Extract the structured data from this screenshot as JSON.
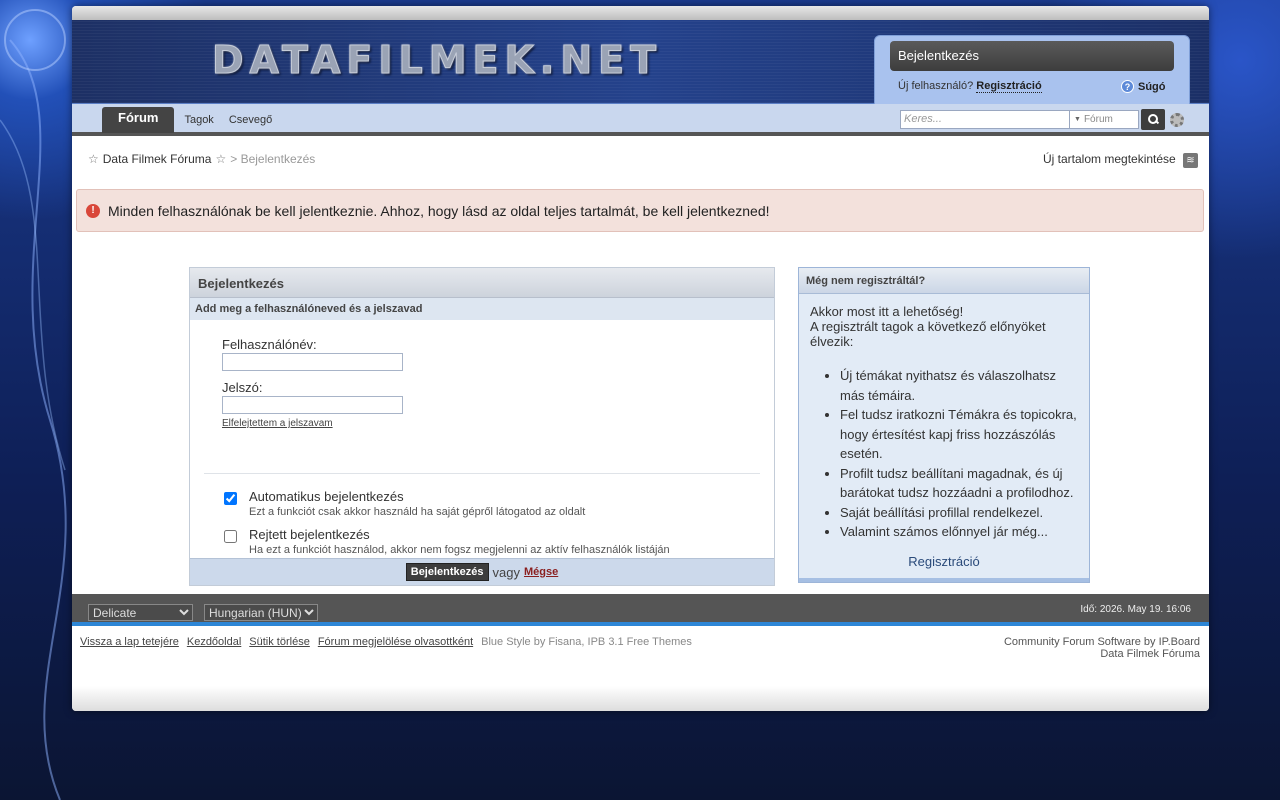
{
  "header": {
    "logo_text": "DATAFILMEK.NET",
    "login_button": "Bejelentkezés",
    "new_user_label": "Új felhasználó?",
    "register_link": "Regisztráció",
    "help_label": "Súgó"
  },
  "nav": {
    "tabs": [
      {
        "label": "Fórum",
        "active": true
      },
      {
        "label": "Tagok",
        "active": false
      },
      {
        "label": "Csevegő",
        "active": false
      }
    ],
    "search_placeholder": "Keres...",
    "search_scope": "Fórum"
  },
  "breadcrumb": {
    "home": "Data Filmek Fóruma",
    "current": "> Bejelentkezés"
  },
  "new_content": "Új tartalom megtekintése",
  "alert": {
    "message": "Minden felhasználónak be kell jelentkeznie. Ahhoz, hogy lásd az oldal teljes tartalmát, be kell jelentkezned!"
  },
  "login_form": {
    "title": "Bejelentkezés",
    "subtitle": "Add meg a felhasználóneved és a jelszavad",
    "username_label": "Felhasználónév:",
    "username_value": "",
    "password_label": "Jelszó:",
    "password_value": "",
    "forgot": "Elfelejtettem a jelszavam",
    "auto_login_title": "Automatikus bejelentkezés",
    "auto_login_desc": "Ezt a funkciót csak akkor használd ha saját gépről látogatod az oldalt",
    "auto_login_checked": true,
    "hidden_login_title": "Rejtett bejelentkezés",
    "hidden_login_desc": "Ha ezt a funkciót használod, akkor nem fogsz megjelenni az aktív felhasználók listáján",
    "hidden_login_checked": false,
    "submit": "Bejelentkezés",
    "or": "vagy",
    "cancel": "Mégse"
  },
  "register_panel": {
    "title": "Még nem regisztráltál?",
    "intro_line1": "Akkor most itt a lehetőség!",
    "intro_line2": "A regisztrált tagok a következő előnyöket élvezik:",
    "benefits": [
      "Új témákat nyithatsz és válaszolhatsz más témáira.",
      "Fel tudsz iratkozni Témákra és topicokra, hogy értesítést kapj friss hozzászólás esetén.",
      "Profilt tudsz beállítani magadnak, és új barátokat tudsz hozzáadni a profilodhoz.",
      "Saját beállítási profillal rendelkezel.",
      "Valamint számos előnnyel jár még..."
    ],
    "register_link": "Regisztráció"
  },
  "footer": {
    "skin_select": "Delicate",
    "lang_select": "Hungarian (HUN)",
    "time": "Idő: 2026. May 19. 16:06",
    "links": [
      "Vissza a lap tetejére",
      "Kezdőoldal",
      "Sütik törlése",
      "Fórum megjelölése olvasottként"
    ],
    "style_credit": "Blue Style by Fisana",
    "themes_credit": "IPB 3.1 Free Themes",
    "software_credit": "Community Forum Software by IP.Board",
    "site_name": "Data Filmek Fóruma"
  }
}
